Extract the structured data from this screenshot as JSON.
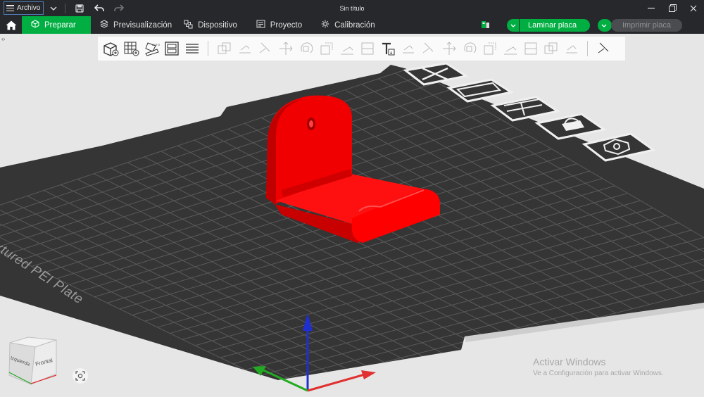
{
  "titlebar": {
    "menu_label": "Archivo",
    "title": "Sin título",
    "icons": [
      "hamburger-icon",
      "chevron-down-icon",
      "save-icon",
      "undo-icon",
      "redo-icon",
      "minimize-icon",
      "restore-icon",
      "close-icon"
    ]
  },
  "nav": {
    "tabs": [
      {
        "label": "Preparar",
        "icon": "cube-outline-icon",
        "active": true
      },
      {
        "label": "Previsualización",
        "icon": "layers-icon",
        "active": false
      },
      {
        "label": "Dispositivo",
        "icon": "device-icon",
        "active": false
      },
      {
        "label": "Proyecto",
        "icon": "project-icon",
        "active": false
      },
      {
        "label": "Calibración",
        "icon": "calibration-icon",
        "active": false
      }
    ],
    "slice_label": "Laminar placa",
    "print_label": "Imprimir placa"
  },
  "toolbar": {
    "tools": [
      "add-object-icon",
      "add-plate-icon",
      "auto-orient-icon",
      "arrange-icon",
      "layers-list-icon",
      "move-icon",
      "rotate-icon",
      "scale-icon",
      "lay-on-face-icon",
      "cut-icon",
      "mesh-boolean-icon",
      "support-paint-icon",
      "seam-paint-icon",
      "text-icon",
      "svg-icon",
      "measure-icon",
      "assembly-icon",
      "split-objects-icon",
      "split-parts-icon",
      "variable-layer-icon",
      "brim-ears-icon",
      "emboss-icon",
      "ruler-icon",
      "assembly-view-icon"
    ]
  },
  "plate": {
    "label": "Textured PEI Plate",
    "model_color": "#ff0000",
    "grid_color": "#3a3a3a"
  },
  "view_cube": {
    "left_face": "Izquierda",
    "front_face": "Frontal"
  },
  "watermark": {
    "title": "Activar Windows",
    "subtitle": "Ve a Configuración para activar Windows."
  },
  "colors": {
    "accent": "#00ae42",
    "chrome": "#26282b",
    "axis_x": "#e03030",
    "axis_y": "#22aa22",
    "axis_z": "#2030d0"
  }
}
